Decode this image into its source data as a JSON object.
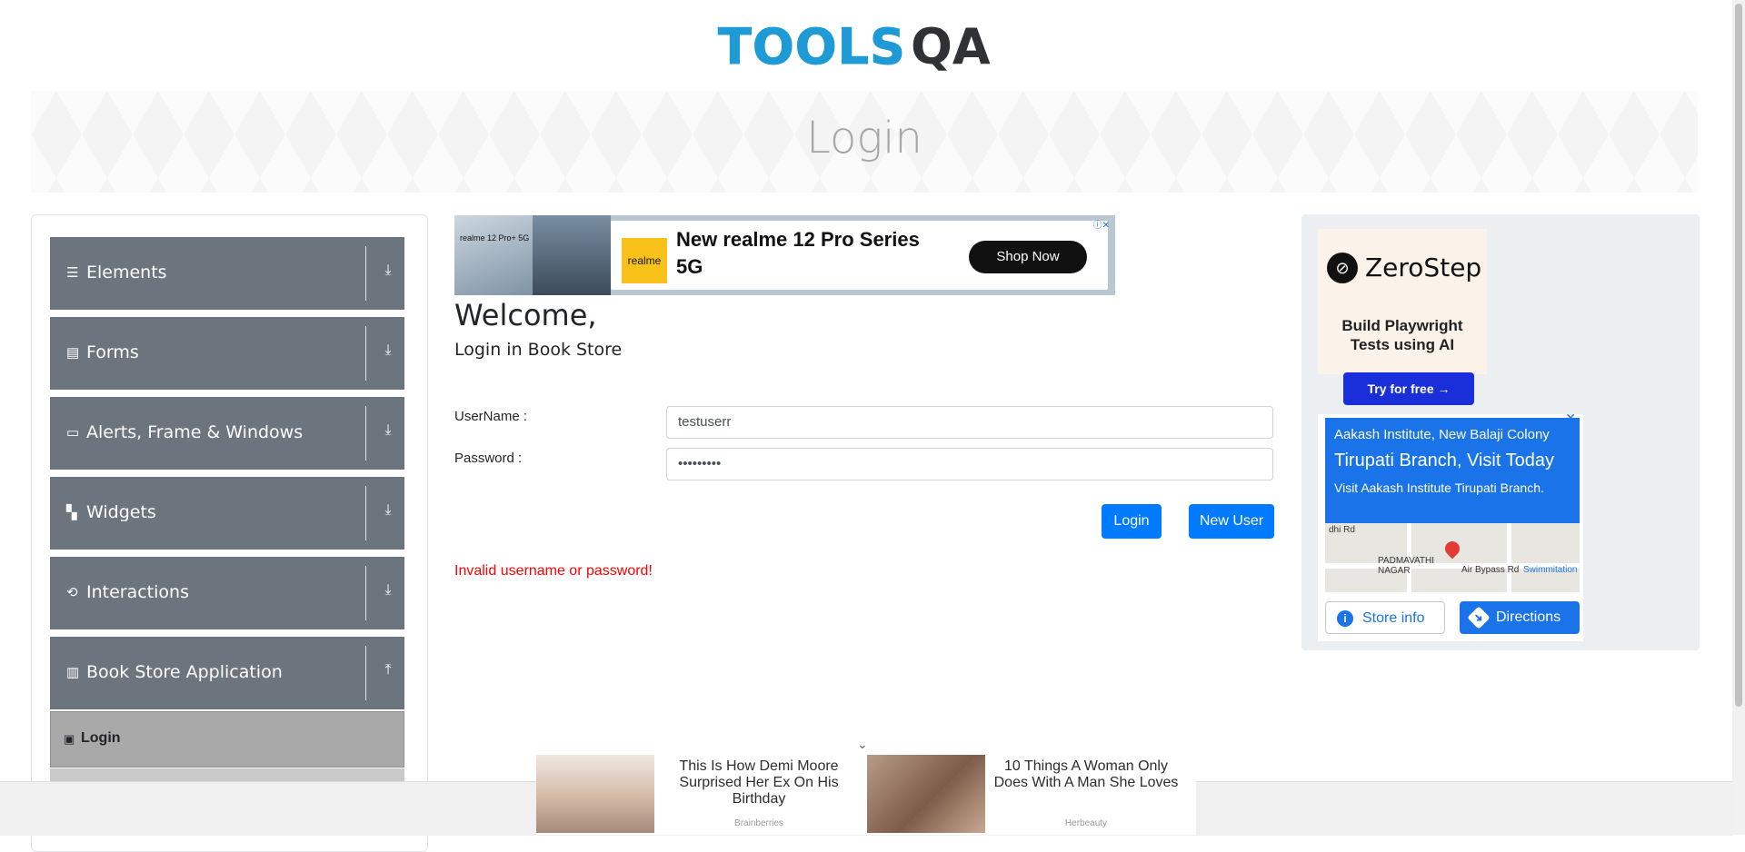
{
  "header": {
    "logo_text_1": "TOOLS",
    "logo_text_2": "QA",
    "page_title": "Login"
  },
  "sidebar": {
    "groups": [
      {
        "label": "Elements",
        "icon": "list-icon",
        "arrow": "⤓"
      },
      {
        "label": "Forms",
        "icon": "form-icon",
        "arrow": "⤓"
      },
      {
        "label": "Alerts, Frame & Windows",
        "icon": "window-icon",
        "arrow": "⤓"
      },
      {
        "label": "Widgets",
        "icon": "widgets-icon",
        "arrow": "⤓"
      },
      {
        "label": "Interactions",
        "icon": "interactions-icon",
        "arrow": "⤓"
      },
      {
        "label": "Book Store Application",
        "icon": "books-icon",
        "arrow": "⤒"
      }
    ],
    "active_item": "Login"
  },
  "ad_top": {
    "small_text": "realme 12 Pro+ 5G",
    "brand": "realme",
    "headline": "New realme 12 Pro Series 5G",
    "cta": "Shop Now"
  },
  "main": {
    "welcome": "Welcome,",
    "subtitle": "Login in Book Store",
    "username_label": "UserName :",
    "username_value": "testuserr",
    "password_label": "Password :",
    "password_value": "•••••••••",
    "login_button": "Login",
    "new_user_button": "New User",
    "error": "Invalid username or password!"
  },
  "right_ad": {
    "zerostep": {
      "title": "ZeroStep",
      "text": "Build Playwright Tests using AI",
      "cta": "Try for free →"
    },
    "aakash": {
      "line1": "Aakash Institute, New Balaji Colony",
      "line2": "Tirupati Branch, Visit Today",
      "line3": "Visit Aakash Institute Tirupati Branch.",
      "map_label_1": "PADMAVATHI NAGAR",
      "map_label_2": "Air Bypass Rd",
      "map_label_3": "Swimmitation",
      "map_label_4": "dhi Rd",
      "store_info": "Store info",
      "directions": "Directions"
    }
  },
  "bottom_ad": {
    "story1": "This Is How Demi Moore Surprised Her Ex On His Birthday",
    "source1": "Brainberries",
    "story2": "10 Things A Woman Only Does With A Man She Loves",
    "source2": "Herbeauty"
  }
}
